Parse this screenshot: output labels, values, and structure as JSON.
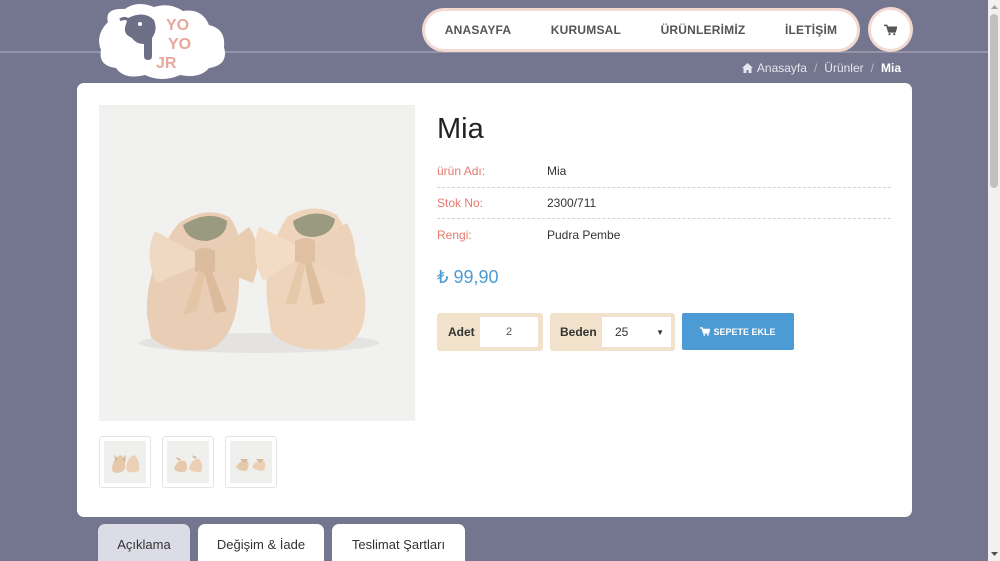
{
  "brand": {
    "logo_letters": [
      "YO",
      "YO",
      "JR"
    ],
    "colors": {
      "letter": "#e7a89b",
      "cloud": "#ffffff",
      "elephant": "#6d6f87"
    }
  },
  "nav": {
    "items": [
      "ANASAYFA",
      "KURUMSAL",
      "ÜRÜNLERİMİZ",
      "İLETİŞİM"
    ],
    "cart_icon": "shopping-cart-icon"
  },
  "breadcrumb": {
    "items": [
      "Anasayfa",
      "Ürünler",
      "Mia"
    ]
  },
  "product": {
    "title": "Mia",
    "specs": [
      {
        "label": "ürün Adı:",
        "value": "Mia"
      },
      {
        "label": "Stok No:",
        "value": "2300/711"
      },
      {
        "label": "Rengi:",
        "value": "Pudra Pembe"
      }
    ],
    "price": "₺ 99,90",
    "quantity": {
      "label": "Adet",
      "value": "2"
    },
    "size": {
      "label": "Beden",
      "value": "25"
    },
    "add_to_cart": "SEPETE EKLE",
    "thumbnail_count": 3
  },
  "tabs": [
    "Açıklama",
    "Değişim & İade",
    "Teslimat Şartları"
  ],
  "colors": {
    "background": "#74758f",
    "accent_blue": "#4c9bd4",
    "label_red": "#e57a6f",
    "input_bg": "#f2e2cc",
    "nav_border": "#f3d9d2"
  }
}
